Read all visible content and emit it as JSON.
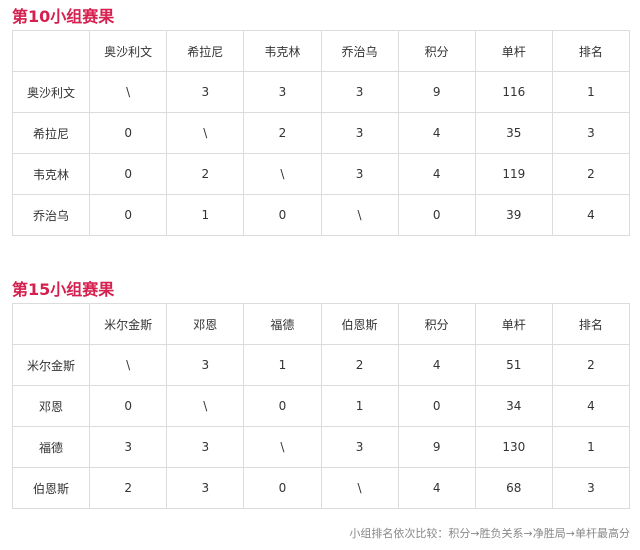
{
  "groups": [
    {
      "title": "第10小组赛果",
      "headers": [
        "",
        "奥沙利文",
        "希拉尼",
        "韦克林",
        "乔治乌",
        "积分",
        "单杆",
        "排名"
      ],
      "rows": [
        [
          "奥沙利文",
          "\\",
          "3",
          "3",
          "3",
          "9",
          "116",
          "1"
        ],
        [
          "希拉尼",
          "0",
          "\\",
          "2",
          "3",
          "4",
          "35",
          "3"
        ],
        [
          "韦克林",
          "0",
          "2",
          "\\",
          "3",
          "4",
          "119",
          "2"
        ],
        [
          "乔治乌",
          "0",
          "1",
          "0",
          "\\",
          "0",
          "39",
          "4"
        ]
      ]
    },
    {
      "title": "第15小组赛果",
      "headers": [
        "",
        "米尔金斯",
        "邓恩",
        "福德",
        "伯恩斯",
        "积分",
        "单杆",
        "排名"
      ],
      "rows": [
        [
          "米尔金斯",
          "\\",
          "3",
          "1",
          "2",
          "4",
          "51",
          "2"
        ],
        [
          "邓恩",
          "0",
          "\\",
          "0",
          "1",
          "0",
          "34",
          "4"
        ],
        [
          "福德",
          "3",
          "3",
          "\\",
          "3",
          "9",
          "130",
          "1"
        ],
        [
          "伯恩斯",
          "2",
          "3",
          "0",
          "\\",
          "4",
          "68",
          "3"
        ]
      ]
    }
  ],
  "footnote": "小组排名依次比较：积分→胜负关系→净胜局→单杆最高分",
  "colors": {
    "title": "#d6204f",
    "border": "#dcdcdc",
    "footnote": "#888888"
  }
}
